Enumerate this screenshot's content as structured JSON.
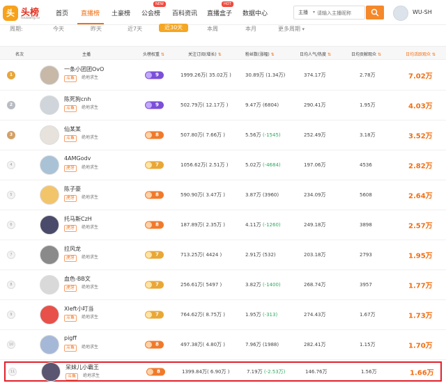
{
  "header": {
    "logo_badge": "头",
    "logo_text": "头榜",
    "logo_sub": "toubang.tv",
    "nav": [
      {
        "label": "首页"
      },
      {
        "label": "直播榜",
        "active": true
      },
      {
        "label": "土豪榜"
      },
      {
        "label": "公会榜",
        "tag": "NEW"
      },
      {
        "label": "百科资讯"
      },
      {
        "label": "直播盒子",
        "tag": "HOT"
      },
      {
        "label": "数据中心"
      }
    ],
    "search": {
      "type": "主播",
      "placeholder": "请输入主播昵称"
    },
    "user_name": "WU-SH",
    "icons": {
      "search": "search-icon",
      "avatar": "user-avatar"
    }
  },
  "filter": {
    "label": "周期:",
    "options": [
      "今天",
      "昨天",
      "近7天",
      "近30天",
      "本周",
      "本月",
      "更多周期"
    ],
    "active_index": 3
  },
  "table": {
    "headers": [
      "名次",
      "主播",
      "头榜权重",
      "关注订阅(增长)",
      "粉丝数(涨幅)",
      "日均人气/热度",
      "日均贡献观众",
      "日均活跃观众"
    ],
    "sort_column": "日均活跃观众",
    "rows": [
      {
        "rank": "1",
        "medal": "gold",
        "name": "一条小团团OvO",
        "platform": "斗鱼",
        "category": "绝地求生",
        "score": "9",
        "score_color": "purple",
        "subs": "1999.26万",
        "subs_growth": "( 35.02万 )",
        "fans": "30.89万",
        "fans_growth": "(1.34万)",
        "fans_neg": false,
        "popularity": "374.17万",
        "contrib": "2.78万",
        "active": "7.02万"
      },
      {
        "rank": "2",
        "medal": "silver",
        "name": "陈死狗cnh",
        "platform": "斗鱼",
        "category": "绝地求生",
        "score": "9",
        "score_color": "purple",
        "subs": "502.79万",
        "subs_growth": "( 12.17万 )",
        "fans": "9.47万",
        "fans_growth": "(6804)",
        "fans_neg": false,
        "popularity": "290.41万",
        "contrib": "1.95万",
        "active": "4.03万"
      },
      {
        "rank": "3",
        "medal": "bronze",
        "name": "仙某某",
        "platform": "斗鱼",
        "category": "绝地求生",
        "score": "8",
        "score_color": "orange",
        "subs": "507.80万",
        "subs_growth": "( 7.66万 )",
        "fans": "5.56万",
        "fans_growth": "(-1545)",
        "fans_neg": true,
        "popularity": "252.49万",
        "contrib": "3.18万",
        "active": "3.52万"
      },
      {
        "rank": "4",
        "medal": "",
        "name": "4AMGodv",
        "platform": "虎牙",
        "category": "绝地求生",
        "score": "7",
        "score_color": "gold",
        "subs": "1056.62万",
        "subs_growth": "( 2.51万 )",
        "fans": "5.02万",
        "fans_growth": "(-4684)",
        "fans_neg": true,
        "popularity": "197.06万",
        "contrib": "4536",
        "active": "2.82万"
      },
      {
        "rank": "5",
        "medal": "",
        "name": "陈子豪",
        "platform": "虎牙",
        "category": "绝地求生",
        "score": "8",
        "score_color": "orange",
        "subs": "590.90万",
        "subs_growth": "( 3.47万 )",
        "fans": "3.87万",
        "fans_growth": "(3960)",
        "fans_neg": false,
        "popularity": "234.09万",
        "contrib": "5608",
        "active": "2.64万"
      },
      {
        "rank": "6",
        "medal": "",
        "name": "托马斯CzH",
        "platform": "虎牙",
        "category": "绝地求生",
        "score": "8",
        "score_color": "orange",
        "subs": "187.89万",
        "subs_growth": "( 2.35万 )",
        "fans": "4.11万",
        "fans_growth": "(-1260)",
        "fans_neg": true,
        "popularity": "249.18万",
        "contrib": "3898",
        "active": "2.57万"
      },
      {
        "rank": "7",
        "medal": "",
        "name": "拉风龙",
        "platform": "虎牙",
        "category": "绝地求生",
        "score": "7",
        "score_color": "gold",
        "subs": "713.25万",
        "subs_growth": "( 4424 )",
        "fans": "2.91万",
        "fans_growth": "(532)",
        "fans_neg": false,
        "popularity": "203.18万",
        "contrib": "2793",
        "active": "1.95万"
      },
      {
        "rank": "8",
        "medal": "",
        "name": "血色-BB文",
        "platform": "虎牙",
        "category": "绝地求生",
        "score": "7",
        "score_color": "gold",
        "subs": "256.61万",
        "subs_growth": "( 5497 )",
        "fans": "3.82万",
        "fans_growth": "(-1400)",
        "fans_neg": true,
        "popularity": "268.74万",
        "contrib": "3957",
        "active": "1.77万"
      },
      {
        "rank": "9",
        "medal": "",
        "name": "Xleft小叮当",
        "platform": "斗鱼",
        "category": "绝地求生",
        "score": "7",
        "score_color": "gold",
        "subs": "764.62万",
        "subs_growth": "( 8.75万 )",
        "fans": "1.95万",
        "fans_growth": "(-313)",
        "fans_neg": true,
        "popularity": "274.43万",
        "contrib": "1.67万",
        "active": "1.73万"
      },
      {
        "rank": "10",
        "medal": "",
        "name": "pigff",
        "platform": "斗鱼",
        "category": "绝地求生",
        "score": "8",
        "score_color": "orange",
        "subs": "497.38万",
        "subs_growth": "( 4.80万 )",
        "fans": "7.96万",
        "fans_growth": "(1988)",
        "fans_neg": false,
        "popularity": "282.41万",
        "contrib": "1.15万",
        "active": "1.70万"
      },
      {
        "rank": "11",
        "medal": "",
        "name": "呆妹儿小霸王",
        "platform": "斗鱼",
        "category": "绝地求生",
        "score": "8",
        "score_color": "orange",
        "subs": "1399.84万",
        "subs_growth": "( 6.90万 )",
        "fans": "7.19万",
        "fans_growth": "(-2.53万)",
        "fans_neg": true,
        "popularity": "146.76万",
        "contrib": "1.56万",
        "active": "1.66万"
      }
    ]
  },
  "colors": {
    "accent": "#f26d0f",
    "highlight_border": "#e0202a",
    "negative": "#2fa75c"
  }
}
